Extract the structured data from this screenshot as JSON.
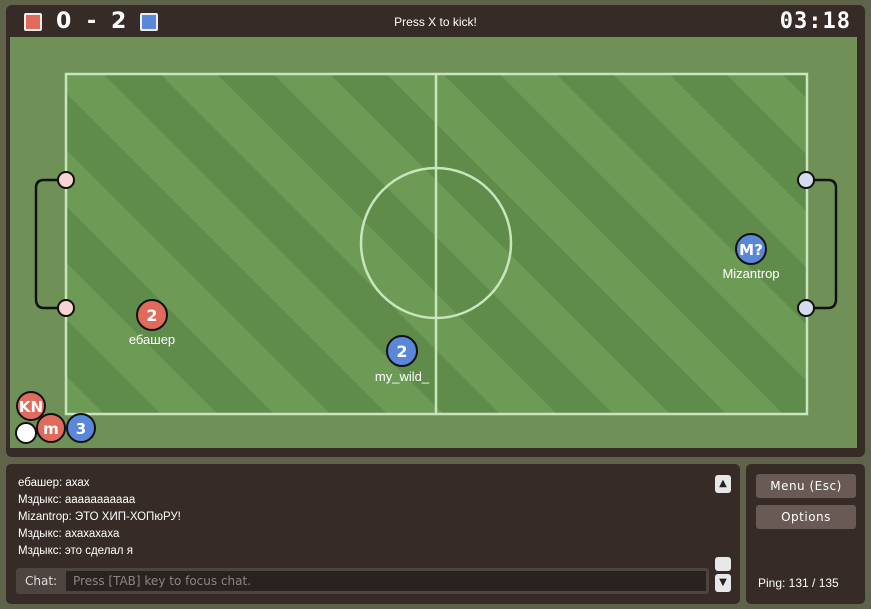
{
  "scoreboard": {
    "red_score": "0",
    "separator": "-",
    "blue_score": "2",
    "red_color": "#e06b5c",
    "blue_color": "#5b87d9",
    "instruction": "Press X to kick!",
    "timer": "03:18"
  },
  "field": {
    "grass_light": "#6d9a55",
    "grass_dark": "#5f8c4a",
    "line_color": "#c7e6bd",
    "players": [
      {
        "label": "ебашер",
        "number": "2",
        "team": "red"
      },
      {
        "label": "my_wild_",
        "number": "2",
        "team": "blue"
      },
      {
        "label": "Mizantrop",
        "number": "M?",
        "team": "blue"
      }
    ],
    "corner_discs": [
      {
        "text": "KN",
        "team": "red"
      },
      {
        "text": "m",
        "team": "red"
      },
      {
        "text": "3",
        "team": "blue"
      }
    ]
  },
  "chat": {
    "messages": [
      "ебашер: ахах",
      "Мздыкс: ааааааааааа",
      "Mizantrop: ЭТО ХИП-ХОПюРУ!",
      "Мздыкс: ахахахаха",
      "Мздыкс: это сделал я"
    ],
    "label": "Chat:",
    "placeholder": "Press [TAB] key to focus chat.",
    "scroll_up": "▲",
    "scroll_down": "▼"
  },
  "side": {
    "menu_label": "Menu (Esc)",
    "options_label": "Options",
    "ping": "Ping: 131 / 135"
  }
}
